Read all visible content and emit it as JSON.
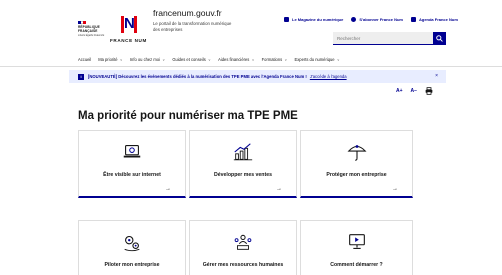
{
  "header": {
    "rf_logo_lines": [
      "RÉPUBLIQUE",
      "FRANÇAISE"
    ],
    "rf_motto": "Liberté Égalité Fraternité",
    "brand_mark": "N",
    "brand_name": "FRANCE NUM",
    "site_title": "francenum.gouv.fr",
    "site_tagline": "Le portail de la transformation numérique des entreprises",
    "links": [
      {
        "label": "Le Magazine du numérique",
        "icon": "magazine-icon"
      },
      {
        "label": "S'abonner France Num",
        "icon": "subscribe-icon"
      },
      {
        "label": "Agenda France Num",
        "icon": "calendar-icon"
      }
    ],
    "search": {
      "placeholder": "Rechercher",
      "icon": "search-icon"
    }
  },
  "nav": {
    "items": [
      {
        "label": "Accueil",
        "has_chevron": false
      },
      {
        "label": "Ma priorité",
        "has_chevron": true
      },
      {
        "label": "Info ou chez moi",
        "has_chevron": true
      },
      {
        "label": "Guides et conseils",
        "has_chevron": true
      },
      {
        "label": "Aides financières",
        "has_chevron": true
      },
      {
        "label": "Formations",
        "has_chevron": true
      },
      {
        "label": "Experts du numérique",
        "has_chevron": true
      }
    ]
  },
  "notice": {
    "icon": "info-icon",
    "text": "[NOUVEAUTÉ] Découvrez les événements dédiés à la numérisation des TPE PME avec l'Agenda France Num !",
    "link": "J'accède à l'agenda",
    "close": "×"
  },
  "tools": {
    "increase": "A+",
    "decrease": "A−",
    "print_icon": "print-icon"
  },
  "page_title": "Ma priorité pour numériser ma TPE PME",
  "cards": [
    {
      "label": "Être visible sur internet",
      "icon": "laptop-icon",
      "arrow": "→"
    },
    {
      "label": "Développer mes ventes",
      "icon": "growth-chart-icon",
      "arrow": "→"
    },
    {
      "label": "Protéger mon entreprise",
      "icon": "umbrella-icon",
      "arrow": "→"
    },
    {
      "label": "Piloter mon entreprise",
      "icon": "gears-icon",
      "arrow": "→"
    },
    {
      "label": "Gérer mes ressources humaines",
      "icon": "team-icon",
      "arrow": "→"
    },
    {
      "label": "Comment démarrer ?",
      "icon": "screen-start-icon",
      "arrow": "→"
    }
  ],
  "colors": {
    "primary": "#000091",
    "accent_red": "#e1000f",
    "notice_bg": "#e8edff",
    "border": "#dddddd"
  }
}
